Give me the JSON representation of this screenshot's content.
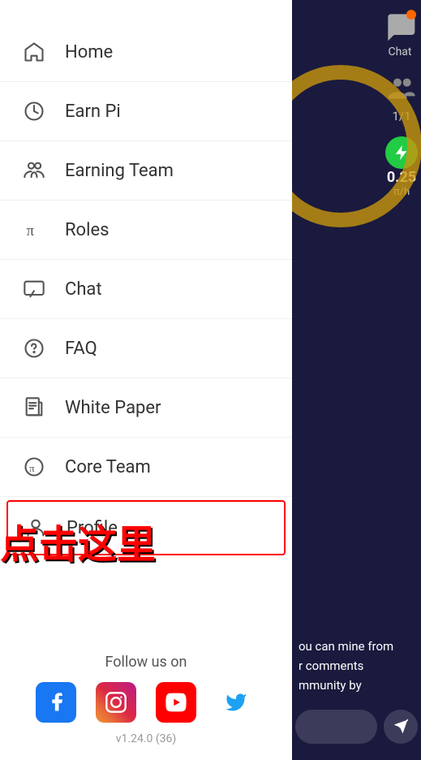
{
  "drawer": {
    "nav_items": [
      {
        "id": "home",
        "label": "Home",
        "icon": "home"
      },
      {
        "id": "earn-pi",
        "label": "Earn Pi",
        "icon": "clock-half"
      },
      {
        "id": "earning-team",
        "label": "Earning Team",
        "icon": "users"
      },
      {
        "id": "roles",
        "label": "Roles",
        "icon": "pi"
      },
      {
        "id": "chat",
        "label": "Chat",
        "icon": "chat"
      },
      {
        "id": "faq",
        "label": "FAQ",
        "icon": "question"
      },
      {
        "id": "white-paper",
        "label": "White Paper",
        "icon": "document"
      },
      {
        "id": "core-team",
        "label": "Core Team",
        "icon": "pi-circle"
      },
      {
        "id": "profile",
        "label": "Profile",
        "icon": "person",
        "active": true
      }
    ],
    "follow_title": "Follow us on",
    "social": [
      {
        "id": "facebook",
        "name": "Facebook"
      },
      {
        "id": "instagram",
        "name": "Instagram"
      },
      {
        "id": "youtube",
        "name": "YouTube"
      },
      {
        "id": "twitter",
        "name": "Twitter"
      }
    ],
    "version": "v1.24.0 (36)"
  },
  "right_panel": {
    "chat_label": "Chat",
    "team_count": "1/1",
    "pi_value": "0.25",
    "pi_unit": "π/h",
    "bottom_text_lines": [
      "ou can mine from",
      "r comments",
      "mmunity by"
    ],
    "chinese_text": "点击这里"
  }
}
